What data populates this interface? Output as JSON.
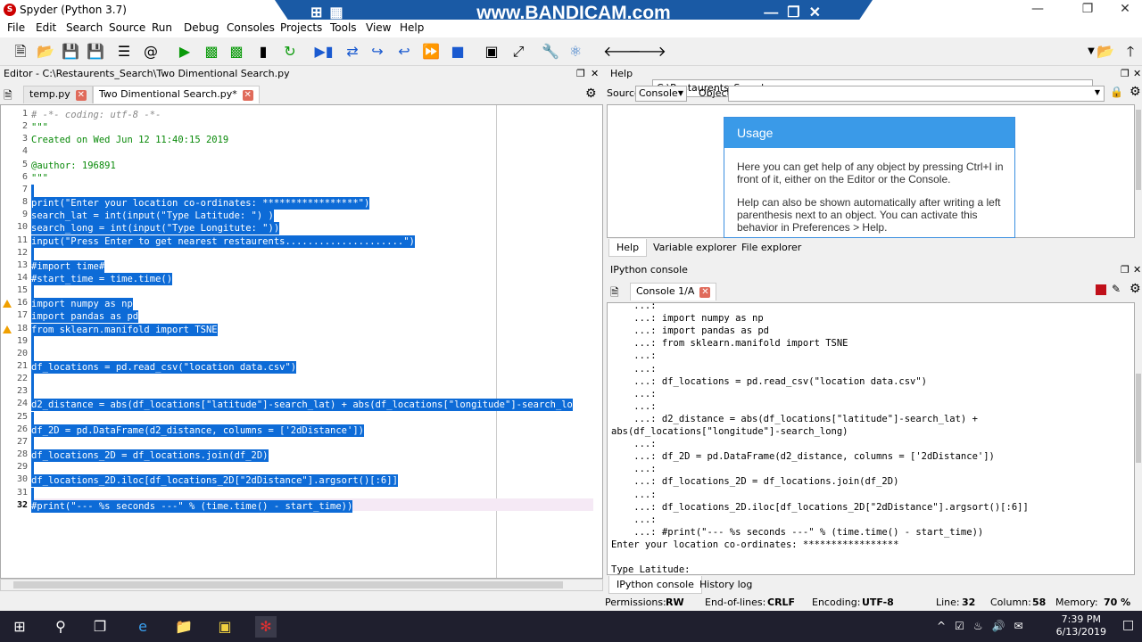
{
  "window": {
    "title": "Spyder (Python 3.7)"
  },
  "watermark": {
    "text": "www.BANDICAM.com"
  },
  "menu": [
    "File",
    "Edit",
    "Search",
    "Source",
    "Run",
    "Debug",
    "Consoles",
    "Projects",
    "Tools",
    "View",
    "Help"
  ],
  "toolbar": {
    "path": "C:\\Restaurents_Search"
  },
  "editor": {
    "header": "Editor - C:\\Restaurents_Search\\Two Dimentional Search.py",
    "tabs": [
      "temp.py",
      "Two Dimentional Search.py*"
    ],
    "lines": [
      "# -*- coding: utf-8 -*-",
      "\"\"\"",
      "Created on Wed Jun 12 11:40:15 2019",
      "",
      "@author: 196891",
      "\"\"\"",
      "",
      "print(\"Enter your location co-ordinates: *****************\")",
      "search_lat = int(input(\"Type Latitude: \") )",
      "search_long = int(input(\"Type Longitute: \"))",
      "input(\"Press Enter to get nearest restaurents.....................\")",
      "",
      "#import time#",
      "#start_time = time.time()",
      "",
      "import numpy as np",
      "import pandas as pd",
      "from sklearn.manifold import TSNE",
      "",
      "",
      "df_locations = pd.read_csv(\"location data.csv\")",
      "",
      "",
      "d2_distance = abs(df_locations[\"latitude\"]-search_lat) + abs(df_locations[\"longitude\"]-search_lo",
      "",
      "df_2D = pd.DataFrame(d2_distance, columns = ['2dDistance'])",
      "",
      "df_locations_2D = df_locations.join(df_2D)",
      "",
      "df_locations_2D.iloc[df_locations_2D[\"2dDistance\"].argsort()[:6]]",
      "",
      "#print(\"--- %s seconds ---\" % (time.time() - start_time))"
    ]
  },
  "help": {
    "header": "Help",
    "source_label": "Source",
    "source_value": "Console",
    "object_label": "Object",
    "usage_title": "Usage",
    "usage_p1": "Here you can get help of any object by pressing Ctrl+I in front of it, either on the Editor or the Console.",
    "usage_p2": "Help can also be shown automatically after writing a left parenthesis next to an object. You can activate this behavior in Preferences > Help.",
    "tabs": [
      "Help",
      "Variable explorer",
      "File explorer"
    ]
  },
  "console": {
    "header": "IPython console",
    "tab": "Console 1/A",
    "lines": [
      "    ...:",
      "    ...: import numpy as np",
      "    ...: import pandas as pd",
      "    ...: from sklearn.manifold import TSNE",
      "    ...:",
      "    ...:",
      "    ...: df_locations = pd.read_csv(\"location data.csv\")",
      "    ...:",
      "    ...:",
      "    ...: d2_distance = abs(df_locations[\"latitude\"]-search_lat) +",
      "abs(df_locations[\"longitude\"]-search_long)",
      "    ...:",
      "    ...: df_2D = pd.DataFrame(d2_distance, columns = ['2dDistance'])",
      "    ...:",
      "    ...: df_locations_2D = df_locations.join(df_2D)",
      "    ...:",
      "    ...: df_locations_2D.iloc[df_locations_2D[\"2dDistance\"].argsort()[:6]]",
      "    ...:",
      "    ...: #print(\"--- %s seconds ---\" % (time.time() - start_time))",
      "Enter your location co-ordinates: *****************",
      "",
      "Type Latitude:"
    ],
    "bottom_tabs": [
      "IPython console",
      "History log"
    ]
  },
  "status": {
    "permissions_label": "Permissions:",
    "permissions": "RW",
    "eol_label": "End-of-lines:",
    "eol": "CRLF",
    "encoding_label": "Encoding:",
    "encoding": "UTF-8",
    "line_label": "Line:",
    "line": "32",
    "column_label": "Column:",
    "column": "58",
    "memory_label": "Memory:",
    "memory": "70 %"
  },
  "taskbar": {
    "time": "7:39 PM",
    "date": "6/13/2019"
  }
}
